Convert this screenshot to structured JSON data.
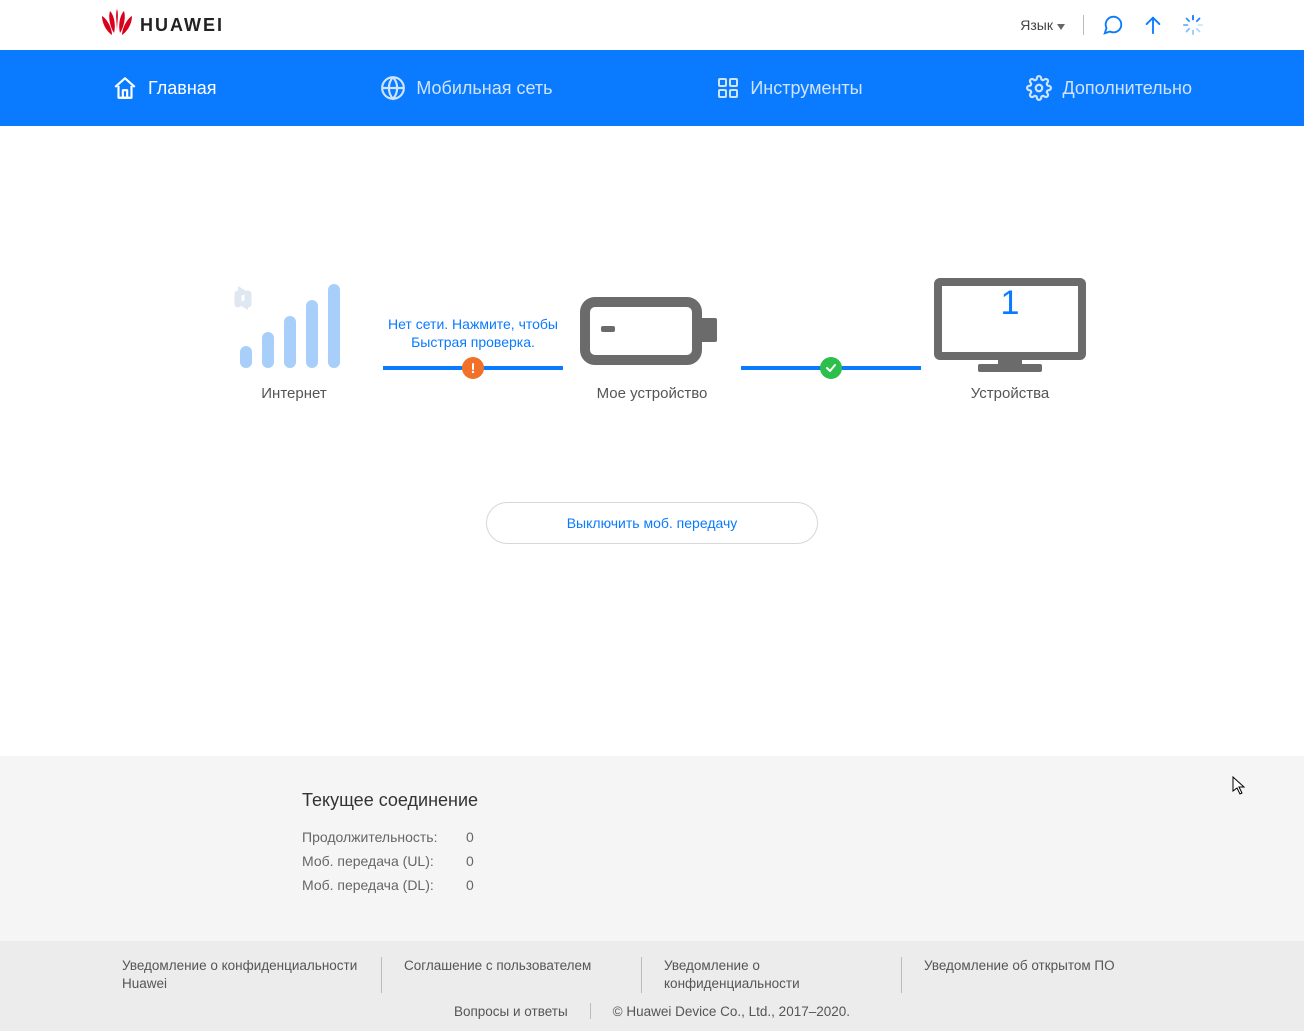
{
  "brand": {
    "name": "HUAWEI"
  },
  "header": {
    "language_label": "Язык",
    "icons": [
      "speech-bubble-icon",
      "arrow-up-icon",
      "loading-icon"
    ]
  },
  "nav": {
    "items": [
      {
        "icon": "home-icon",
        "label": "Главная",
        "active": true
      },
      {
        "icon": "globe-icon",
        "label": "Мобильная сеть",
        "active": false
      },
      {
        "icon": "grid-icon",
        "label": "Инструменты",
        "active": false
      },
      {
        "icon": "gear-icon",
        "label": "Дополнительно",
        "active": false
      }
    ]
  },
  "status": {
    "internet_label": "Интернет",
    "device_label": "Мое устройство",
    "devices_label": "Устройства",
    "devices_count": "1",
    "link1_message": "Нет сети. Нажмите, чтобы Быстрая проверка.",
    "link1_state": "warn",
    "link2_message": "",
    "link2_state": "ok"
  },
  "toggle_button": "Выключить моб. передачу",
  "connection": {
    "title": "Текущее соединение",
    "rows": [
      {
        "k": "Продолжительность:",
        "v": "0"
      },
      {
        "k": "Моб. передача (UL):",
        "v": "0"
      },
      {
        "k": "Моб. передача (DL):",
        "v": "0"
      }
    ]
  },
  "footer": {
    "links": [
      "Уведомление о конфиденциальности Huawei",
      "Соглашение с пользователем",
      "Уведомление о конфиденциальности",
      "Уведомление об открытом ПО"
    ],
    "faq": "Вопросы и ответы",
    "copyright": "© Huawei Device Co., Ltd., 2017–2020."
  }
}
